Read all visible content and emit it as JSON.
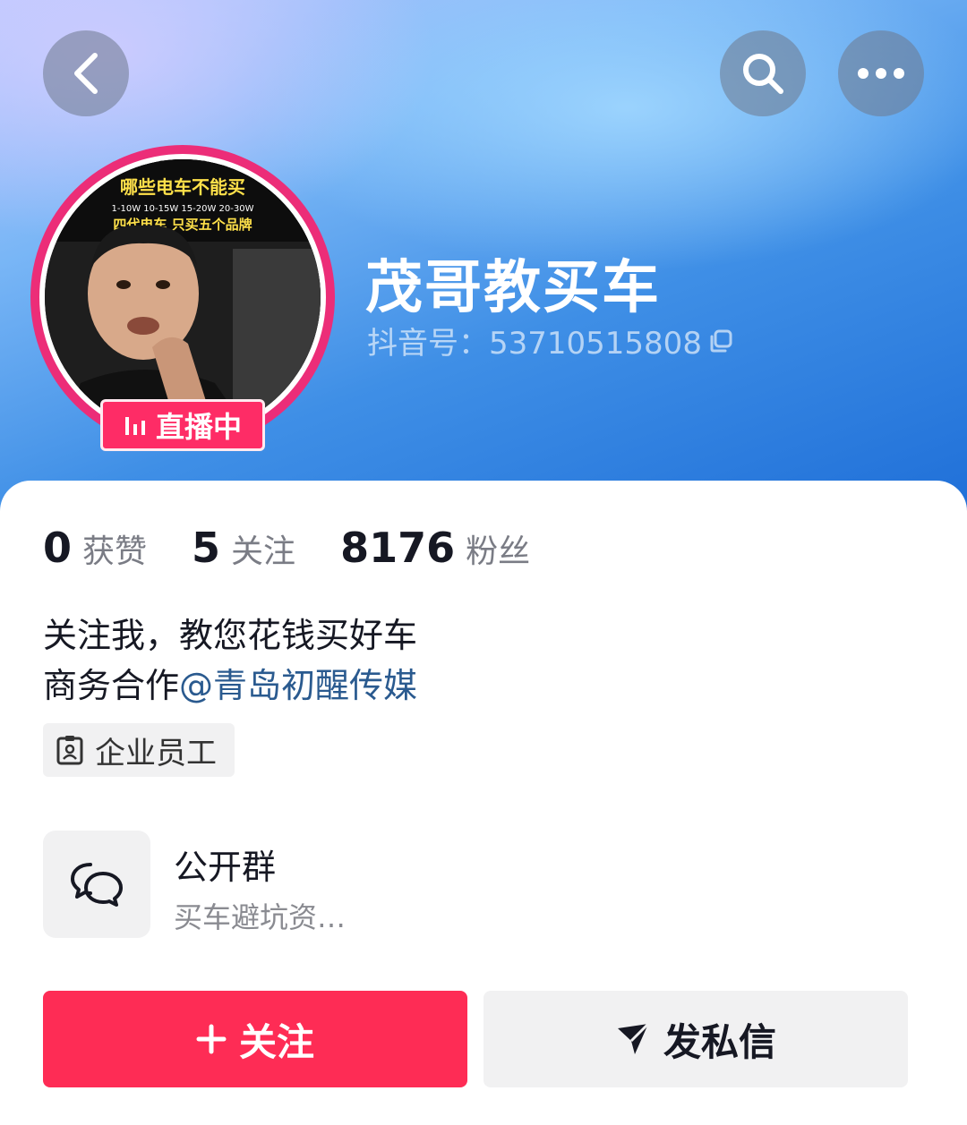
{
  "nav": {
    "back_icon": "chevron-left-icon",
    "search_icon": "search-icon",
    "more_icon": "more-horizontal-icon"
  },
  "profile": {
    "name": "茂哥教买车",
    "douyin_id": "抖音号：53710515808",
    "live_badge": "直播中",
    "avatar_caption_line1": "哪些电车不能买",
    "avatar_caption_line2": "1-10W 10-15W 15-20W 20-30W",
    "avatar_caption_line3": "四代电车 只买五个品牌"
  },
  "stats": [
    {
      "value": "0",
      "label": "获赞"
    },
    {
      "value": "5",
      "label": "关注"
    },
    {
      "value": "8176",
      "label": "粉丝"
    }
  ],
  "bio": {
    "line1": "关注我，教您花钱买好车",
    "line2_prefix": "商务合作",
    "line2_mention": "@青岛初醒传媒"
  },
  "tag": {
    "label": "企业员工",
    "icon": "badge-icon"
  },
  "group": {
    "title": "公开群",
    "subtitle": "买车避坑资…",
    "icon": "chat-bubbles-icon"
  },
  "actions": {
    "follow_label": "关注",
    "message_label": "发私信"
  },
  "colors": {
    "brand_red": "#fe2c55",
    "live_pink": "#ec2d78",
    "mention_blue": "#2a5a8f"
  }
}
